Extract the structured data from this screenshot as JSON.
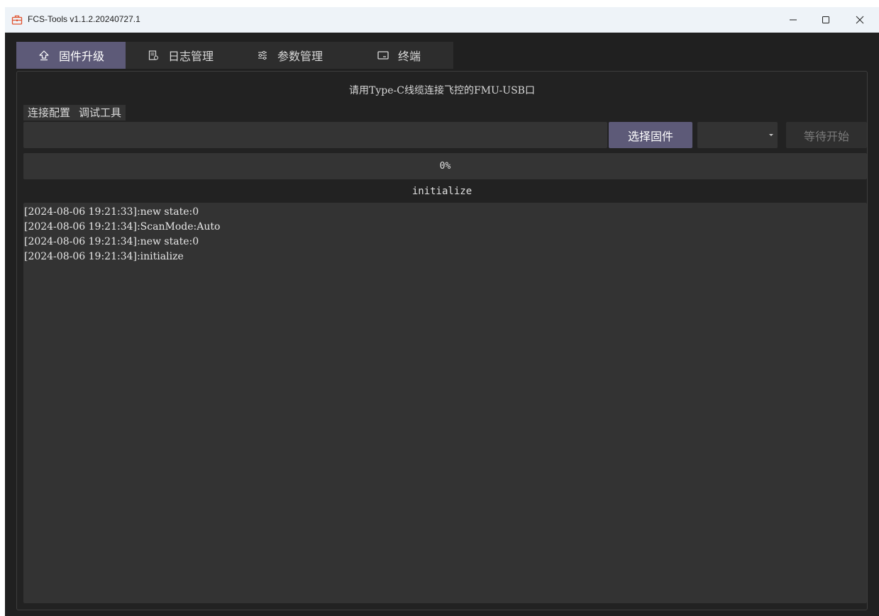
{
  "window": {
    "title": "FCS-Tools v1.1.2.20240727.1",
    "controls": {
      "minimize": "minimize-icon",
      "maximize": "maximize-icon",
      "close": "close-icon"
    }
  },
  "tabs": [
    {
      "label": "固件升级",
      "icon": "upload-icon",
      "active": true
    },
    {
      "label": "日志管理",
      "icon": "log-icon",
      "active": false
    },
    {
      "label": "参数管理",
      "icon": "sliders-icon",
      "active": false
    },
    {
      "label": "终端",
      "icon": "terminal-icon",
      "active": false
    }
  ],
  "firmware": {
    "hint": "请用Type-C线缆连接飞控的FMU-USB口",
    "subtabs": [
      "连接配置",
      "调试工具"
    ],
    "file_path": "",
    "select_button": "选择固件",
    "combo_value": "",
    "start_button": "等待开始",
    "progress": {
      "value": 0,
      "label": "0%"
    },
    "status": "initialize",
    "log": [
      "[2024-08-06 19:21:33]:new state:0",
      "[2024-08-06 19:21:34]:ScanMode:Auto",
      "[2024-08-06 19:21:34]:new state:0",
      "[2024-08-06 19:21:34]:initialize"
    ]
  },
  "colors": {
    "accent": "#5d5a78",
    "background": "#202020",
    "panel": "#333333",
    "titlebar": "#eef3f8"
  }
}
